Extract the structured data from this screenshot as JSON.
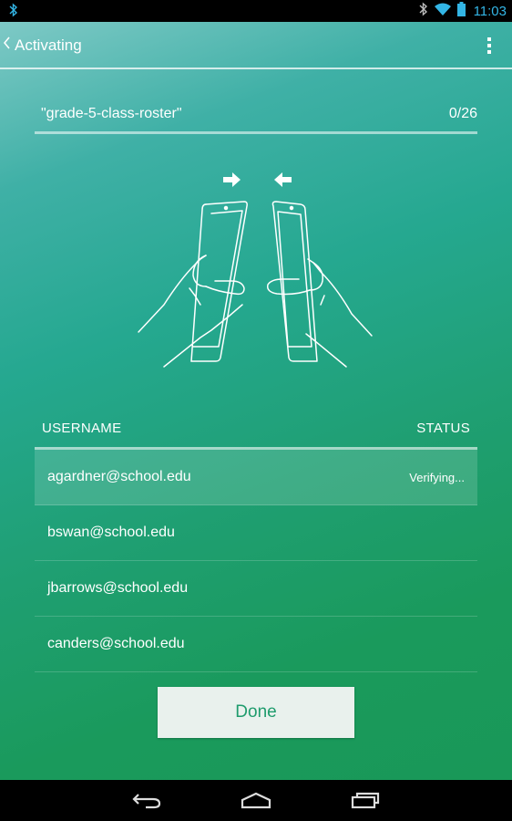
{
  "status_bar": {
    "time": "11:03",
    "icons": [
      "bluetooth-icon",
      "wifi-icon",
      "battery-icon"
    ],
    "accent_color": "#33b5e5"
  },
  "action_bar": {
    "title": "Activating",
    "up_icon": "chevron-left-icon",
    "overflow_icon": "more-vert-icon"
  },
  "roster": {
    "name": "\"grade-5-class-roster\"",
    "progress": "0/26"
  },
  "illustration": {
    "icon": "tablets-bump-icon",
    "arrows": [
      "arrow-right-icon",
      "arrow-left-icon"
    ]
  },
  "table": {
    "headers": {
      "username": "USERNAME",
      "status": "STATUS"
    },
    "rows": [
      {
        "username": "agardner@school.edu",
        "status": "Verifying...",
        "active": true
      },
      {
        "username": "bswan@school.edu",
        "status": "",
        "active": false
      },
      {
        "username": "jbarrows@school.edu",
        "status": "",
        "active": false
      },
      {
        "username": "canders@school.edu",
        "status": "",
        "active": false
      }
    ]
  },
  "done_button": {
    "label": "Done",
    "text_color": "#1f9c6d"
  },
  "nav_bar": {
    "buttons": [
      "back-icon",
      "home-icon",
      "recents-icon"
    ]
  },
  "colors": {
    "gradient_top": "#7ec9c6",
    "gradient_bottom": "#199858"
  }
}
